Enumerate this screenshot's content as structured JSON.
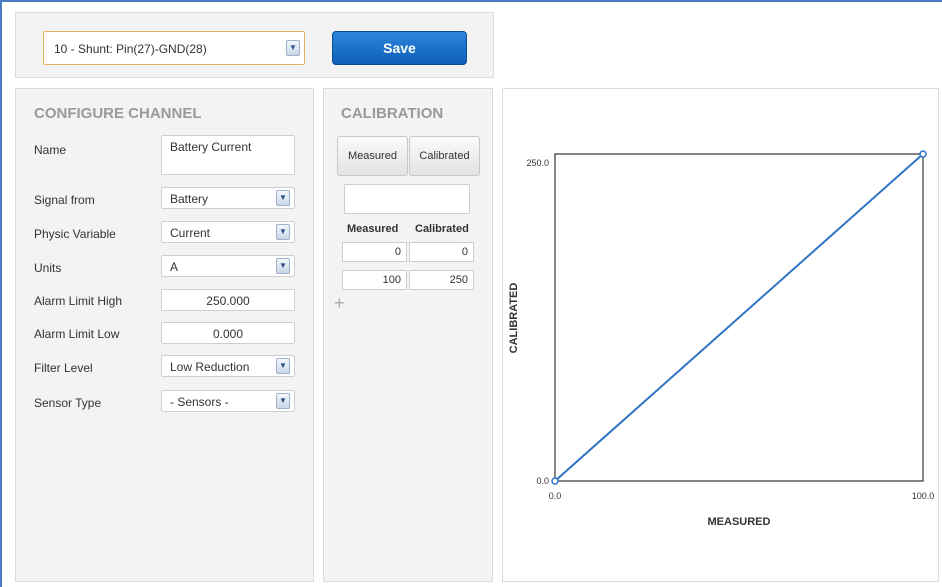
{
  "channel_selector": {
    "value": "10 - Shunt: Pin(27)-GND(28)"
  },
  "toolbar": {
    "save_label": "Save"
  },
  "configure": {
    "title": "CONFIGURE CHANNEL",
    "name": {
      "label": "Name",
      "value": "Battery Current"
    },
    "signal_from": {
      "label": "Signal from",
      "value": "Battery"
    },
    "physic_variable": {
      "label": "Physic Variable",
      "value": "Current"
    },
    "units": {
      "label": "Units",
      "value": "A"
    },
    "alarm_high": {
      "label": "Alarm Limit High",
      "value": "250.000"
    },
    "alarm_low": {
      "label": "Alarm Limit Low",
      "value": "0.000"
    },
    "filter_level": {
      "label": "Filter Level",
      "value": "Low Reduction"
    },
    "sensor_type": {
      "label": "Sensor Type",
      "value": "- Sensors -"
    }
  },
  "calibration": {
    "title": "CALIBRATION",
    "measured_button": "Measured",
    "calibrated_button": "Calibrated",
    "col_measured": "Measured",
    "col_calibrated": "Calibrated",
    "rows": [
      {
        "measured": "0",
        "calibrated": "0"
      },
      {
        "measured": "100",
        "calibrated": "250"
      }
    ],
    "add_icon": "+"
  },
  "chart_data": {
    "type": "line",
    "xlabel": "MEASURED",
    "ylabel": "CALIBRATED",
    "x": [
      0,
      100
    ],
    "y": [
      0,
      250
    ],
    "xlim": [
      0,
      100
    ],
    "ylim": [
      0,
      250
    ],
    "xticks": [
      "0.0",
      "100.0"
    ],
    "yticks": [
      "0.0",
      "250.0"
    ],
    "line_color": "#2f74c4"
  }
}
